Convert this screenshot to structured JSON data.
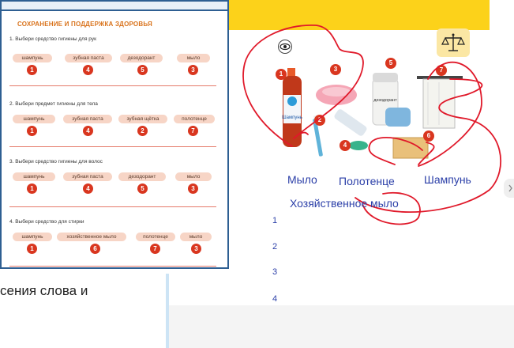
{
  "worksheet": {
    "title": "СОХРАНЕНИЕ И ПОДДЕРЖКА ЗДОРОВЬЯ",
    "questions": [
      {
        "text": "1. Выбери средство гигиены для рук",
        "options": [
          "шампунь",
          "зубная паста",
          "дезодорант",
          "мыло"
        ],
        "numbers": [
          "1",
          "4",
          "5",
          "3"
        ]
      },
      {
        "text": "2. Выбери предмет гигиены для тела",
        "options": [
          "шампунь",
          "зубная паста",
          "зубная щётка",
          "полотенце"
        ],
        "numbers": [
          "1",
          "4",
          "2",
          "7"
        ]
      },
      {
        "text": "3. Выбери средство гигиены для волос",
        "options": [
          "шампунь",
          "зубная паста",
          "дезодорант",
          "мыло"
        ],
        "numbers": [
          "1",
          "4",
          "5",
          "3"
        ]
      },
      {
        "text": "4. Выбери средство для стирки",
        "options": [
          "шампунь",
          "хозяйственное мыло",
          "полотенце",
          "мыло"
        ],
        "numbers": [
          "1",
          "6",
          "7",
          "3"
        ]
      }
    ]
  },
  "fragment_text": "сения слова и",
  "picture": {
    "badges": [
      "1",
      "2",
      "3",
      "4",
      "5",
      "6",
      "7"
    ],
    "shampoo_label": "Шампунь",
    "deodorant_label": "дезодорант"
  },
  "answer_words": {
    "soap": "Мыло",
    "towel": "Полотенце",
    "shampoo": "Шампунь",
    "laundry_soap": "Хозяйственное мыло"
  },
  "answer_numbers": [
    "1",
    "2",
    "3",
    "4"
  ],
  "colors": {
    "accent": "#fcd21a",
    "badge": "#d9361f",
    "ink": "#2b3fa8",
    "annotation": "#e0192a"
  },
  "icons": {
    "eye": "eye-icon",
    "scale": "balance-scale-icon"
  }
}
